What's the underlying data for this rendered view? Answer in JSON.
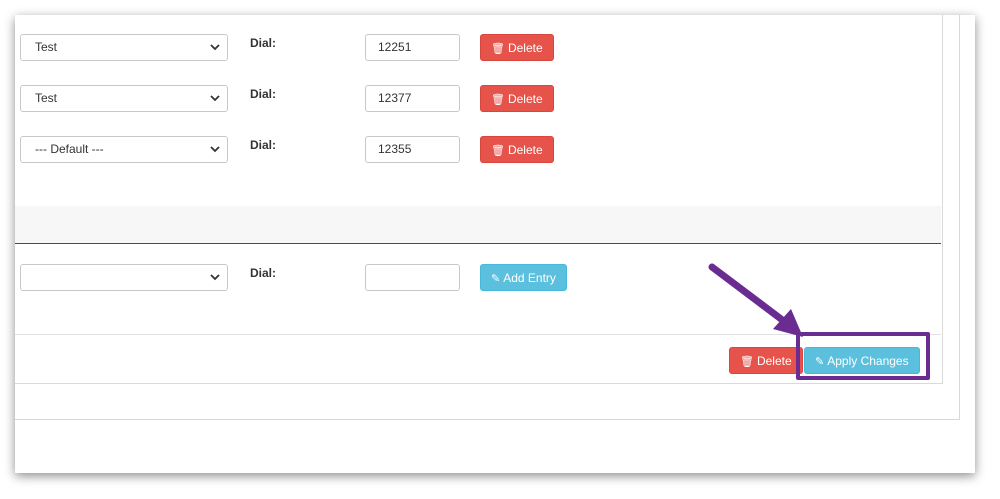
{
  "rows": [
    {
      "select_value": "Test",
      "dial_label": "Dial:",
      "dial_value": "12251",
      "delete_label": "Delete"
    },
    {
      "select_value": "Test",
      "dial_label": "Dial:",
      "dial_value": "12377",
      "delete_label": "Delete"
    },
    {
      "select_value": "--- Default ---",
      "dial_label": "Dial:",
      "dial_value": "12355",
      "delete_label": "Delete"
    }
  ],
  "new_entry": {
    "select_value": "",
    "dial_label": "Dial:",
    "dial_value": "",
    "add_label": "Add Entry"
  },
  "footer": {
    "delete_label": "Delete",
    "apply_label": "Apply Changes"
  },
  "colors": {
    "danger": "#e5534b",
    "info": "#5bc0de",
    "annotation": "#6a2c91"
  },
  "icons": {
    "trash": "trash-icon",
    "edit": "edit-icon",
    "chevron": "chevron-down-icon"
  }
}
